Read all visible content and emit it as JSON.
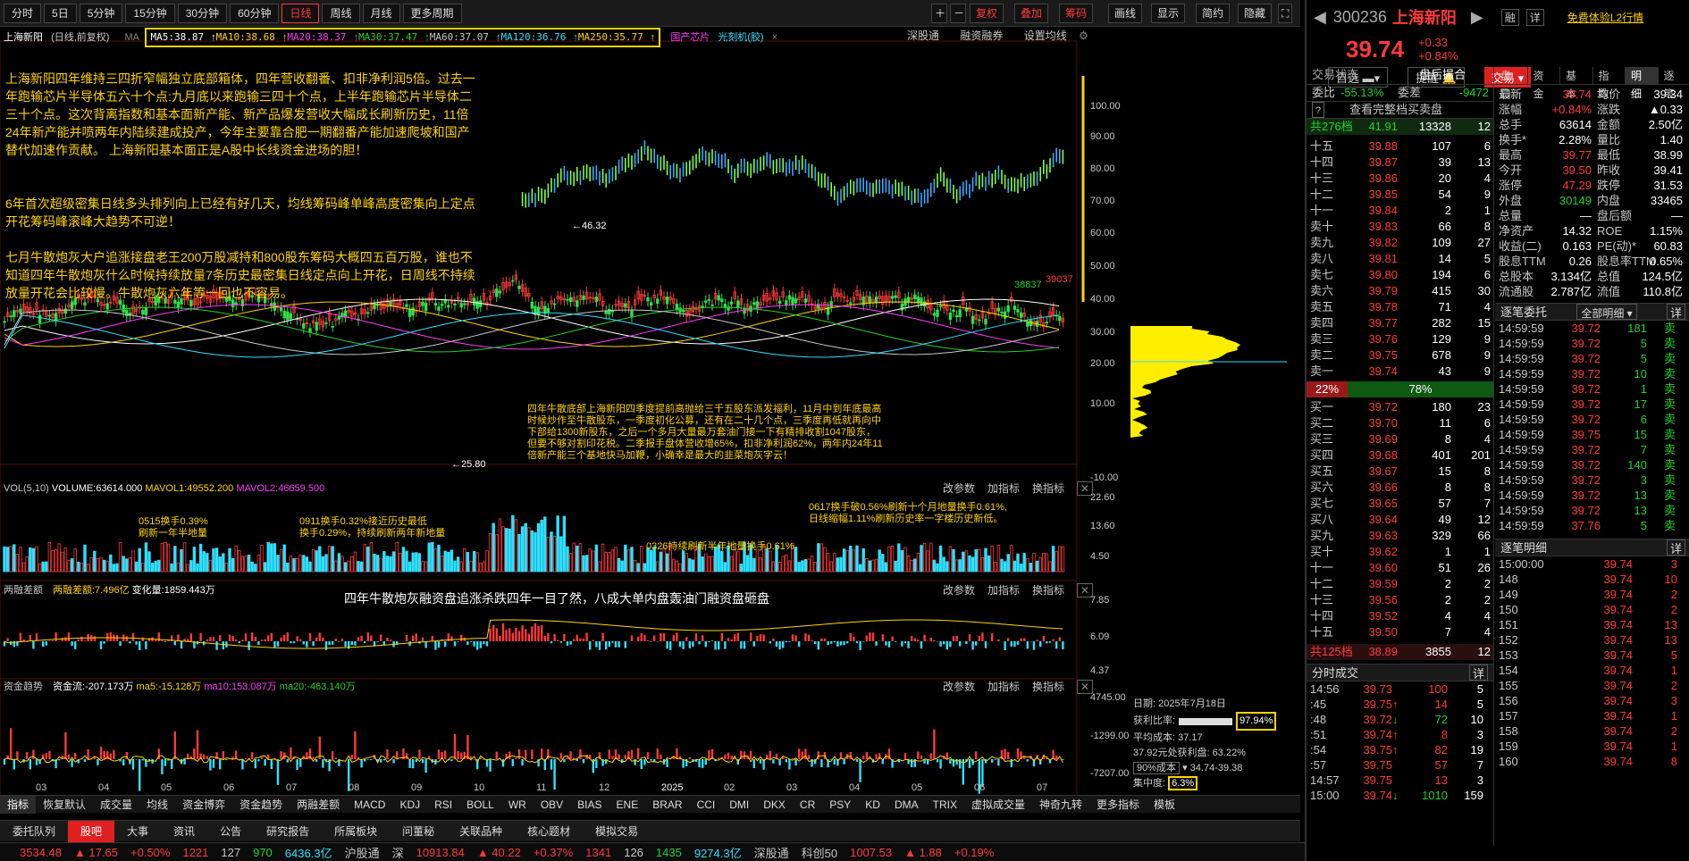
{
  "toolbar": {
    "periods": [
      "分时",
      "5日",
      "5分钟",
      "15分钟",
      "30分钟",
      "60分钟",
      "日线",
      "周线",
      "月线",
      "更多周期"
    ],
    "active": "日线",
    "right": [
      "复权",
      "叠加",
      "筹码",
      "画线",
      "显示",
      "简约",
      "隐藏"
    ]
  },
  "stock_line": {
    "name": "上海新阳",
    "mode": "(日线,前复权)",
    "ma": [
      {
        "t": "MA5:38.87",
        "c": "#ffffff"
      },
      {
        "t": "MA10:38.68",
        "c": "#ffd400"
      },
      {
        "t": "MA20:38.37",
        "c": "#ff3aff"
      },
      {
        "t": "MA30:37.47",
        "c": "#22d22a"
      },
      {
        "t": "MA60:37.07",
        "c": "#c8c8c8"
      },
      {
        "t": "MA120:36.76",
        "c": "#2ee0ff"
      },
      {
        "t": "MA250:35.77",
        "c": "#ffd400"
      }
    ],
    "tags": [
      "国产芯片",
      "光刻机(胶)"
    ],
    "links": [
      "深股通",
      "融资融券",
      "设置均线"
    ]
  },
  "annotation": {
    "p1": "上海新阳四年维持三四折窄幅独立底部箱体，四年营收翻番、扣非净利润5倍。过去一年跑输芯片半导体五六十个点:九月底以来跑输三四十个点，上半年跑输芯片半导体二三十个点。这次背离指数和基本面新产能、新产品爆发营收大幅成长刷新历史，11倍24年新产能并喷两年内陆续建成投产，今年主要靠合肥一期翻番产能加速爬坡和国产替代加速作贡献。 上海新阳基本面正是A股中长线资金进场的胆！",
    "p2": "6年首次超级密集日线多头排列向上已经有好几天，均线筹码峰单峰高度密集向上定点开花筹码峰滚峰大趋势不可逆！",
    "p3": "七月牛散炮灰大户追涨接盘老王200万股减持和800股东筹码大概四五百万股，谁也不知道四年牛散炮灰什么时候持续放量7条历史最密集日线定点向上开花，日周线不持续放量开花会比较慢。牛散炮灰六年等一回也不容易。",
    "box": "四年牛散底部上海新阳四季度提前高抛给三千五股东派发福利，11月中到年底最高时候炒作至牛散股东，一季度初化公募，还有在二十几个点，三季度再低就再向中下部给1300新股东，之后一个多月大量最万套油门接一下有精排收割1047股东，但要不够对割印花税。二季报手盘体营收增65%，扣非净利润62%，两年内24年11倍新产能三个基地快马加鞭，小确幸是最大的韭菜炮灰字云！",
    "hi": "46.32",
    "lo": "25.80",
    "peak1": "38837",
    "peak2": "39037"
  },
  "price_axis": [
    "100.00",
    "90.00",
    "80.00",
    "70.00",
    "60.00",
    "50.00",
    "40.00",
    "30.00",
    "20.00",
    "10.00",
    "-10.00"
  ],
  "vol": {
    "title": "VOL(5,10)",
    "v": "VOLUME:63614.000",
    "m1": "MAVOL1:49552.200",
    "m2": "MAVOL2:46659.500",
    "axis": [
      "22.60",
      "13.60",
      "4.50"
    ],
    "a1": "0515换手0.39%\n刷新一年半地量",
    "a2": "0911换手0.32%接近历史最低\n换手0.29%，持续刷新两年新地量",
    "a3": "0326持续刷新半年地量换手0.61%",
    "a4": "0617换手破0.56%刷新十个月地量换手0.61%,\n日线缩幅1.11%刷新历史率一字楼历史新低。"
  },
  "margin": {
    "title": "两融差额",
    "v": "两融差额:7.496亿",
    "chg": "变化量:1859.443万",
    "headline": "四年牛散炮灰融资盘追涨杀跌四年一目了然，八成大单内盘轰油门融资盘砸盘",
    "axis": [
      "7.85",
      "6.09",
      "4.37"
    ]
  },
  "fund": {
    "title": "资金趋势",
    "v": "资金流:-207.173万",
    "m5": "ma5:-15.128万",
    "m10": "ma10:153.087万",
    "m20": "ma20:-463.140万",
    "axis": [
      "4745.00",
      "-1299.00",
      "-7207.00"
    ]
  },
  "panel_links": [
    "改参数",
    "加指标",
    "换指标"
  ],
  "chip": {
    "date": "日期: 2025年7月18日",
    "profit_lbl": "获利比率:",
    "profit": "97.94%",
    "avg": "平均成本: 37.17",
    "cost_lbl": "37.92元处获利盘:",
    "cost": "63.22%",
    "range_lbl": "90%成本",
    "range": "34.74-39.38",
    "conc_lbl": "集中度:",
    "conc": "6.3%"
  },
  "xaxis": [
    "03",
    "04",
    "05",
    "06",
    "07",
    "08",
    "09",
    "10",
    "11",
    "12",
    "2025",
    "02",
    "03",
    "04",
    "05",
    "06",
    "07"
  ],
  "ind_tabs": [
    "指标",
    "恢复默认",
    "成交量",
    "均线",
    "资金博弈",
    "资金趋势",
    "两融差额",
    "MACD",
    "KDJ",
    "RSI",
    "BOLL",
    "WR",
    "OBV",
    "BIAS",
    "ENE",
    "BRAR",
    "CCI",
    "DMI",
    "DKX",
    "CR",
    "PSY",
    "KD",
    "DMA",
    "TRIX",
    "虚拟成交量",
    "神奇九转",
    "更多指标",
    "模板"
  ],
  "bottom_tabs": [
    "委托队列",
    "股吧",
    "大事",
    "资讯",
    "公告",
    "研究报告",
    "所属板块",
    "问董秘",
    "关联品种",
    "核心题材",
    "模拟交易"
  ],
  "status": {
    "sh": "3534.48",
    "sh_chg": "▲ 17.65",
    "sh_pct": "+0.50%",
    "sh_up": "1221",
    "sh_flat": "127",
    "sh_dn": "970",
    "sh_amt": "6436.3亿",
    "hgt": "沪股通",
    "sz_lbl": "深",
    "sz": "10913.84",
    "sz_chg": "▲ 40.22",
    "sz_pct": "+0.37%",
    "sz_up": "1341",
    "sz_flat": "126",
    "sz_dn": "1435",
    "sz_amt": "9274.3亿",
    "sgt": "深股通",
    "kc": "科创50",
    "kc_v": "1007.53",
    "kc_chg": "▲ 1.88",
    "kc_pct": "+0.19%"
  },
  "quote": {
    "code": "300236",
    "name": "上海新阳",
    "price": "39.74",
    "chg": "+0.33",
    "pct": "+0.84%",
    "btn1": "融",
    "btn2": "详",
    "l2": "免费体验L2行情",
    "sel": "自选",
    "remind": "提醒",
    "trade": "交易",
    "tabs": [
      "盘口",
      "资金",
      "基本",
      "指数",
      "明细",
      "逐笔"
    ],
    "state": "交易状态",
    "state_v": "盘后撮合",
    "wb_lbl": "委比",
    "wb": "-55.13%",
    "wc_lbl": "委差",
    "wc": "-9472",
    "full": "查看完整档买卖盘",
    "sell_total": {
      "l": "共276档",
      "p": "41.91",
      "v": "13328",
      "n": "12"
    },
    "asks": [
      [
        "十五",
        "39.88",
        "107",
        "6"
      ],
      [
        "十四",
        "39.87",
        "39",
        "13"
      ],
      [
        "十三",
        "39.86",
        "20",
        "4"
      ],
      [
        "十二",
        "39.85",
        "54",
        "9"
      ],
      [
        "十一",
        "39.84",
        "2",
        "1"
      ],
      [
        "卖十",
        "39.83",
        "66",
        "8"
      ],
      [
        "卖九",
        "39.82",
        "109",
        "27"
      ],
      [
        "卖八",
        "39.81",
        "14",
        "5"
      ],
      [
        "卖七",
        "39.80",
        "194",
        "6"
      ],
      [
        "卖六",
        "39.79",
        "415",
        "30"
      ],
      [
        "卖五",
        "39.78",
        "71",
        "4"
      ],
      [
        "卖四",
        "39.77",
        "282",
        "15"
      ],
      [
        "卖三",
        "39.76",
        "129",
        "9"
      ],
      [
        "卖二",
        "39.75",
        "678",
        "9"
      ],
      [
        "卖一",
        "39.74",
        "43",
        "9"
      ]
    ],
    "ratio_l": "22%",
    "ratio_r": "78%",
    "bids": [
      [
        "买一",
        "39.72",
        "180",
        "23"
      ],
      [
        "买二",
        "39.70",
        "11",
        "6"
      ],
      [
        "买三",
        "39.69",
        "8",
        "4"
      ],
      [
        "买四",
        "39.68",
        "401",
        "201"
      ],
      [
        "买五",
        "39.67",
        "15",
        "8"
      ],
      [
        "买六",
        "39.66",
        "8",
        "8"
      ],
      [
        "买七",
        "39.65",
        "57",
        "7"
      ],
      [
        "买八",
        "39.64",
        "49",
        "12"
      ],
      [
        "买九",
        "39.63",
        "329",
        "66"
      ],
      [
        "买十",
        "39.62",
        "1",
        "1"
      ],
      [
        "十一",
        "39.60",
        "51",
        "26"
      ],
      [
        "十二",
        "39.59",
        "2",
        "2"
      ],
      [
        "十三",
        "39.56",
        "2",
        "2"
      ],
      [
        "十四",
        "39.52",
        "4",
        "4"
      ],
      [
        "十五",
        "39.50",
        "7",
        "4"
      ]
    ],
    "buy_total": {
      "l": "共125档",
      "p": "38.89",
      "v": "3855",
      "n": "12"
    },
    "stats": [
      [
        "最新",
        "39.74",
        "均价",
        "39.34"
      ],
      [
        "涨幅",
        "+0.84%",
        "涨跌",
        "▲0.33"
      ],
      [
        "总手",
        "63614",
        "金额",
        "2.50亿"
      ],
      [
        "换手*",
        "2.28%",
        "量比",
        "1.40"
      ],
      [
        "最高",
        "39.77",
        "最低",
        "38.99"
      ],
      [
        "今开",
        "39.50",
        "昨收",
        "39.41"
      ],
      [
        "涨停",
        "47.29",
        "跌停",
        "31.53"
      ],
      [
        "外盘",
        "30149",
        "内盘",
        "33465"
      ],
      [
        "总量",
        "—",
        "盘后额",
        "—"
      ],
      [
        "净资产",
        "14.32",
        "ROE",
        "1.15%"
      ],
      [
        "收益(二)",
        "0.163",
        "PE(动)*",
        "60.83"
      ],
      [
        "股息TTM",
        "0.26",
        "股息率TTM",
        "0.65%"
      ],
      [
        "总股本",
        "3.134亿",
        "总值",
        "124.5亿"
      ],
      [
        "流通股",
        "2.787亿",
        "流值",
        "110.8亿"
      ]
    ],
    "entrust_title": "逐笔委托",
    "entrust_sel": "全部明细",
    "entrust_btn": "详",
    "entrust": [
      [
        "14:59:59",
        "39.72",
        "181",
        "卖"
      ],
      [
        "14:59:59",
        "39.72",
        "5",
        "卖"
      ],
      [
        "14:59:59",
        "39.72",
        "5",
        "卖"
      ],
      [
        "14:59:59",
        "39.72",
        "10",
        "卖"
      ],
      [
        "14:59:59",
        "39.72",
        "1",
        "卖"
      ],
      [
        "14:59:59",
        "39.72",
        "17",
        "卖"
      ],
      [
        "14:59:59",
        "39.72",
        "6",
        "卖"
      ],
      [
        "14:59:59",
        "39.75",
        "15",
        "卖"
      ],
      [
        "14:59:59",
        "39.72",
        "7",
        "卖"
      ],
      [
        "14:59:59",
        "39.72",
        "140",
        "卖"
      ],
      [
        "14:59:59",
        "39.72",
        "3",
        "卖"
      ],
      [
        "14:59:59",
        "39.72",
        "13",
        "卖"
      ],
      [
        "14:59:59",
        "39.72",
        "13",
        "卖"
      ],
      [
        "14:59:59",
        "37.76",
        "5",
        "卖"
      ]
    ],
    "detail_title": "逐笔明细",
    "detail_btn": "详",
    "detail": [
      [
        "15:00:00",
        "39.74",
        "3"
      ],
      [
        "148",
        "39.74",
        "10"
      ],
      [
        "149",
        "39.74",
        "2"
      ],
      [
        "150",
        "39.74",
        "2"
      ],
      [
        "151",
        "39.74",
        "13"
      ],
      [
        "152",
        "39.74",
        "13"
      ],
      [
        "153",
        "39.74",
        "5"
      ],
      [
        "154",
        "39.74",
        "1"
      ],
      [
        "155",
        "39.74",
        "2"
      ],
      [
        "156",
        "39.74",
        "3"
      ],
      [
        "157",
        "39.74",
        "1"
      ],
      [
        "158",
        "39.74",
        "2"
      ],
      [
        "159",
        "39.74",
        "1"
      ],
      [
        "160",
        "39.74",
        "8"
      ]
    ],
    "trade_title": "分时成交",
    "trade_btn": "详",
    "trades": [
      [
        "14:56",
        "39.73",
        "",
        "100",
        "5"
      ],
      [
        ":45",
        "39.75",
        "↑",
        "14",
        "5"
      ],
      [
        ":48",
        "39.72",
        "↓",
        "72",
        "10"
      ],
      [
        ":51",
        "39.74",
        "↑",
        "8",
        "3"
      ],
      [
        ":54",
        "39.75",
        "↑",
        "82",
        "19"
      ],
      [
        ":57",
        "39.75",
        "",
        "57",
        "7"
      ],
      [
        "14:57",
        "39.75",
        "",
        "13",
        "3"
      ],
      [
        "15:00",
        "39.74",
        "↓",
        "1010",
        "159"
      ]
    ]
  }
}
